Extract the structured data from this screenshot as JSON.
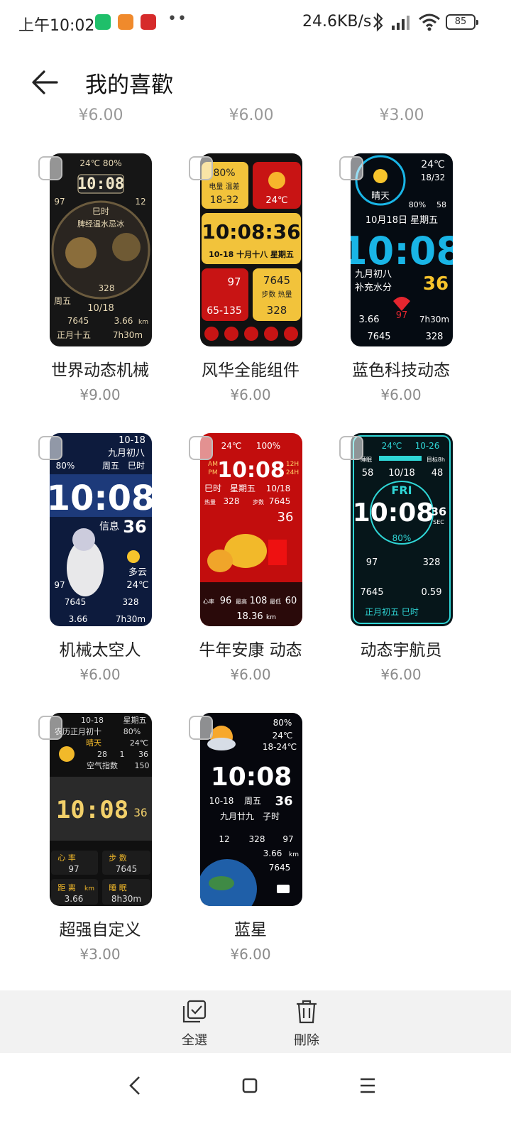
{
  "status_bar": {
    "time": "上午10:02",
    "app_icons": [
      {
        "name": "shield-app-icon",
        "color": "#1fbf6a"
      },
      {
        "name": "orange-app-icon",
        "color": "#f08a2c"
      },
      {
        "name": "red-app-icon",
        "color": "#d62b2b"
      }
    ],
    "more": "••",
    "net_speed": "24.6KB/s",
    "battery": "85"
  },
  "header": {
    "back_icon": "arrow-left-icon",
    "title": "我的喜歡"
  },
  "previous_row_prices": [
    "¥6.00",
    "¥6.00",
    "¥3.00"
  ],
  "items": [
    {
      "name": "世界动态机械",
      "price": "¥9.00",
      "style": "mechanical",
      "face": {
        "top": "24℃ 80%",
        "left": "97",
        "right": "12",
        "time": "10:08",
        "label": "巳时",
        "banner": "脾经温水忌冰",
        "steps": "328",
        "day": "周五",
        "date": "10/18",
        "steps2": "7645",
        "dist": "3.66",
        "dist_unit": "km",
        "lunar": "正月十五",
        "sleep": "7h30m"
      }
    },
    {
      "name": "风华全能组件",
      "price": "¥6.00",
      "style": "widgets",
      "face": {
        "battery": "80%",
        "tag": "电量 温差",
        "range": "18-32",
        "temp": "24℃",
        "time": "10:08:36",
        "date_line": "10-18 十月十八 星期五",
        "heart": "97",
        "steps": "7645",
        "step_tags": "步数 热量",
        "heart_range": "65-135",
        "kcal": "328"
      }
    },
    {
      "name": "蓝色科技动态",
      "price": "¥6.00",
      "style": "blue-tech",
      "face": {
        "temp": "24℃",
        "range": "18/32",
        "weather": "晴天",
        "battery": "80%",
        "uv": "58",
        "date_line": "10月18日 星期五",
        "time": "10:08",
        "lunar": "九月初八",
        "tip": "补充水分",
        "seconds": "36",
        "dist": "3.66",
        "heart": "97",
        "sleep": "7h30m",
        "steps": "7645",
        "kcal": "328"
      }
    },
    {
      "name": "机械太空人",
      "price": "¥6.00",
      "style": "astronaut",
      "face": {
        "date": "10-18",
        "lunar": "九月初八",
        "battery": "80%",
        "day": "周五",
        "hour": "巳时",
        "time": "10:08",
        "msg": "信息",
        "seconds": "36",
        "weather": "多云",
        "temp": "24℃",
        "heart": "97",
        "steps": "7645",
        "kcal": "328",
        "dist": "3.66",
        "sleep": "7h30m"
      }
    },
    {
      "name": "牛年安康 动态",
      "price": "¥6.00",
      "style": "new-year",
      "face": {
        "temp": "24℃",
        "battery": "100%",
        "am": "AM",
        "pm": "PM",
        "h12": "12H",
        "h24": "24H",
        "time": "10:08",
        "hour": "巳时",
        "day": "星期五",
        "date": "10/18",
        "kcal_label": "热量",
        "kcal": "328",
        "steps_label": "步数",
        "steps": "7645",
        "seconds": "36",
        "heart_label": "心率",
        "heart": "96",
        "high_label": "最高",
        "high": "108",
        "low_label": "最低",
        "low": "60",
        "dist": "18.36",
        "dist_unit": "km"
      }
    },
    {
      "name": "动态宇航员",
      "price": "¥6.00",
      "style": "cyan-astronaut",
      "face": {
        "temp": "24℃",
        "date": "10-26",
        "sleep_label": "睡眠",
        "goal": "目标8h",
        "left": "58",
        "mid_date": "10/18",
        "right": "48",
        "dayname": "FRI",
        "time": "10:08",
        "seconds": "36",
        "sec_label": "SEC",
        "pct": "80%",
        "heart": "97",
        "kcal": "328",
        "steps": "7645",
        "dist": "0.59",
        "lunar": "正月初五 巳时"
      }
    },
    {
      "name": "超强自定义",
      "price": "¥3.00",
      "style": "custom",
      "face": {
        "date": "10-18",
        "day": "星期五",
        "lunar": "农历正月初十",
        "battery": "80%",
        "weather": "晴天",
        "temp": "24℃",
        "n1": "28",
        "n2": "1",
        "n3": "36",
        "aqi_label": "空气指数",
        "aqi": "150",
        "time": "10:08",
        "seconds": "36",
        "heart_label": "心 率",
        "heart": "97",
        "steps_label": "步 数",
        "steps": "7645",
        "dist_label": "距 离",
        "dist_unit": "km",
        "dist": "3.66",
        "sleep_label": "睡 眠",
        "sleep": "8h30m"
      }
    },
    {
      "name": "蓝星",
      "price": "¥6.00",
      "style": "blue-planet",
      "face": {
        "battery": "80%",
        "temp": "24℃",
        "range": "18-24℃",
        "time": "10:08",
        "date": "10-18",
        "day": "周五",
        "seconds": "36",
        "lunar": "九月廿九",
        "hour": "子时",
        "n1": "12",
        "kcal": "328",
        "heart": "97",
        "dist": "3.66",
        "dist_unit": "km",
        "steps": "7645"
      }
    }
  ],
  "actions": {
    "select_all": "全選",
    "delete": "刪除"
  },
  "colors": {
    "accent": "#1f1f1f",
    "price": "#8a8a8a",
    "action_bar": "#f2f2f2"
  }
}
